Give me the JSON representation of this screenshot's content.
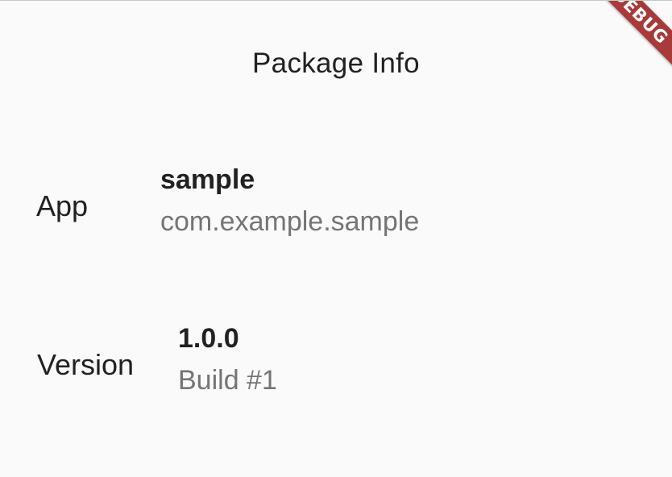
{
  "app_bar": {
    "title": "Package Info"
  },
  "rows": [
    {
      "label": "App",
      "primary": "sample",
      "secondary": "com.example.sample"
    },
    {
      "label": "Version",
      "primary": "1.0.0",
      "secondary": "Build #1"
    }
  ],
  "debug_banner": {
    "label": "DEBUG",
    "color": "#a83a3a"
  },
  "colors": {
    "background": "#fafafa",
    "primary_text": "#212121",
    "secondary_text": "#757575"
  }
}
